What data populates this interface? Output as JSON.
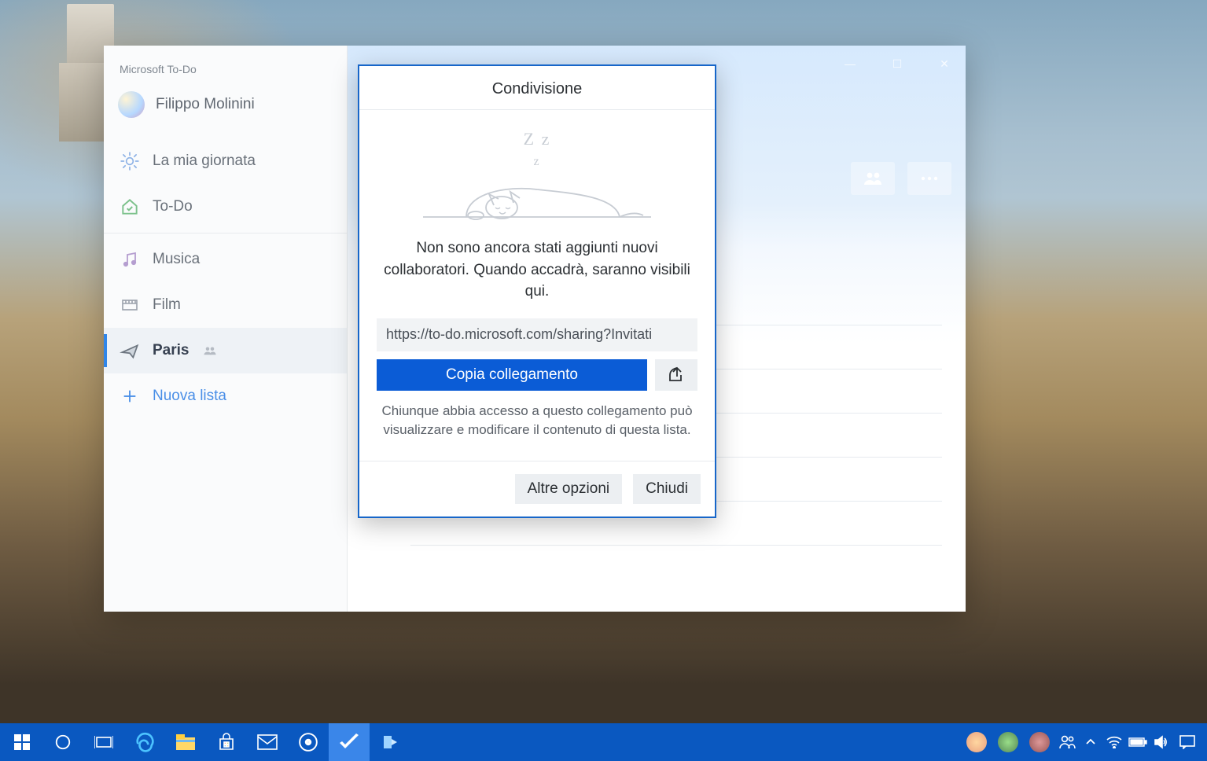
{
  "app": {
    "title": "Microsoft To-Do"
  },
  "profile": {
    "name": "Filippo Molinini"
  },
  "sidebar": {
    "my_day": "La mia giornata",
    "todo": "To-Do",
    "items": [
      {
        "label": "Musica"
      },
      {
        "label": "Film"
      },
      {
        "label": "Paris",
        "selected": true,
        "shared": true
      }
    ],
    "new_list": "Nuova lista"
  },
  "modal": {
    "title": "Condivisione",
    "empty_message": "Non sono ancora stati aggiunti nuovi collaboratori. Quando accadrà, saranno visibili qui.",
    "share_url": "https://to-do.microsoft.com/sharing?Invitati",
    "copy_label": "Copia collegamento",
    "share_note": "Chiunque abbia accesso a questo collegamento può visualizzare e modificare il contenuto di questa lista.",
    "more_options": "Altre opzioni",
    "close": "Chiudi"
  },
  "window_controls": {
    "minimize": "—",
    "maximize": "☐",
    "close": "✕"
  }
}
